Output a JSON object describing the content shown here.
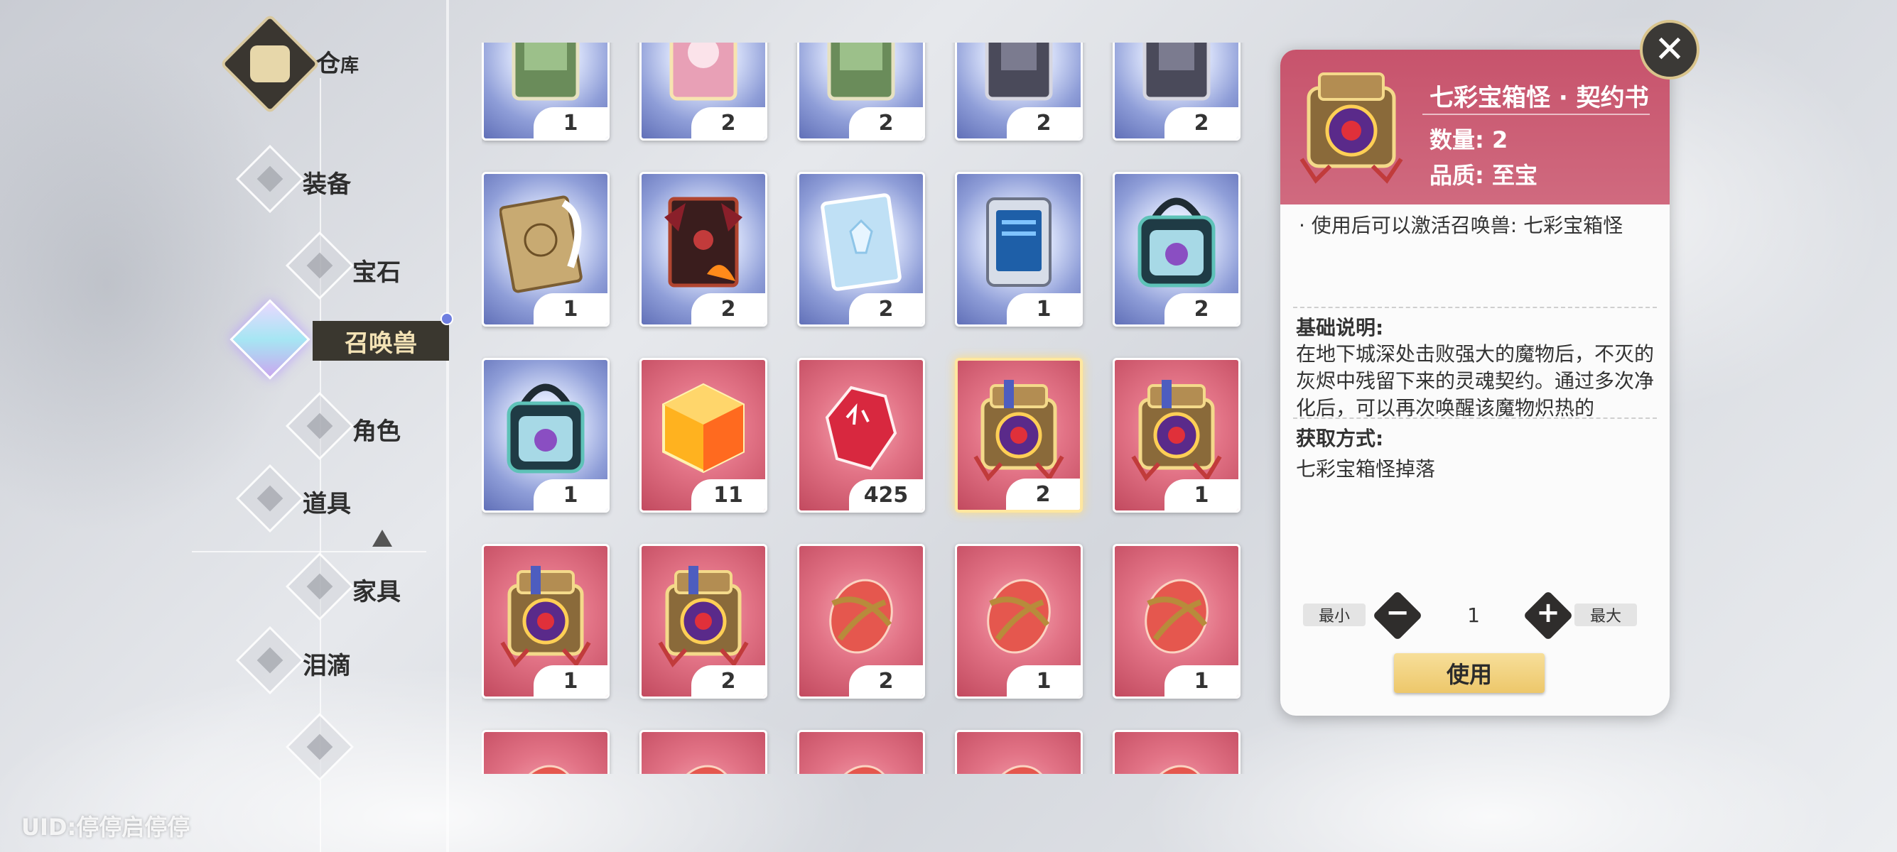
{
  "header": {
    "title_main": "仓",
    "title_sub": "库"
  },
  "nav": {
    "items": [
      {
        "label": "装备"
      },
      {
        "label": "宝石"
      },
      {
        "label": "召唤兽"
      },
      {
        "label": "角色"
      },
      {
        "label": "道具"
      },
      {
        "label": "家具"
      },
      {
        "label": "泪滴"
      }
    ],
    "active_index": 2
  },
  "grid": {
    "rows": [
      [
        {
          "count": "1",
          "kind": "book-green",
          "bg": "blue"
        },
        {
          "count": "2",
          "kind": "book-pink",
          "bg": "blue"
        },
        {
          "count": "2",
          "kind": "book-green",
          "bg": "blue"
        },
        {
          "count": "2",
          "kind": "book-dark",
          "bg": "blue"
        },
        {
          "count": "2",
          "kind": "book-dark",
          "bg": "blue"
        }
      ],
      [
        {
          "count": "1",
          "kind": "book-feather",
          "bg": "blue"
        },
        {
          "count": "2",
          "kind": "book-demon",
          "bg": "blue"
        },
        {
          "count": "2",
          "kind": "book-ice",
          "bg": "blue"
        },
        {
          "count": "1",
          "kind": "tablet",
          "bg": "blue"
        },
        {
          "count": "2",
          "kind": "bag",
          "bg": "blue"
        }
      ],
      [
        {
          "count": "1",
          "kind": "bag",
          "bg": "blue"
        },
        {
          "count": "11",
          "kind": "cube",
          "bg": "red"
        },
        {
          "count": "425",
          "kind": "crystal",
          "bg": "red"
        },
        {
          "count": "2",
          "kind": "chest",
          "bg": "red",
          "selected": true
        },
        {
          "count": "1",
          "kind": "chest",
          "bg": "red"
        }
      ],
      [
        {
          "count": "1",
          "kind": "chest",
          "bg": "red"
        },
        {
          "count": "2",
          "kind": "chest",
          "bg": "red"
        },
        {
          "count": "2",
          "kind": "egg",
          "bg": "red"
        },
        {
          "count": "1",
          "kind": "egg",
          "bg": "red"
        },
        {
          "count": "1",
          "kind": "egg",
          "bg": "red"
        }
      ],
      [
        {
          "count": "",
          "kind": "egg",
          "bg": "red"
        },
        {
          "count": "",
          "kind": "egg",
          "bg": "red"
        },
        {
          "count": "",
          "kind": "egg",
          "bg": "red"
        },
        {
          "count": "",
          "kind": "egg",
          "bg": "red"
        },
        {
          "count": "",
          "kind": "egg",
          "bg": "red"
        }
      ]
    ]
  },
  "detail": {
    "title": "七彩宝箱怪 · 契约书",
    "quantity": "数量: 2",
    "quality": "品质: 至宝",
    "effect": "· 使用后可以激活召唤兽: 七彩宝箱怪",
    "basic_head": "基础说明:",
    "basic_text": "在地下城深处击败强大的魔物后，不灭的灰烬中残留下来的灵魂契约。通过多次净化后，可以再次唤醒该魔物炽热的",
    "source_head": "获取方式:",
    "source_text": "七彩宝箱怪掉落",
    "min_label": "最小",
    "max_label": "最大",
    "amount": "1",
    "use_label": "使用"
  },
  "footer": {
    "uid": "UID:停停启停停"
  },
  "colors": {
    "accent_red": "#c7536c",
    "gold": "#edc76a",
    "dark": "#3a372f"
  }
}
